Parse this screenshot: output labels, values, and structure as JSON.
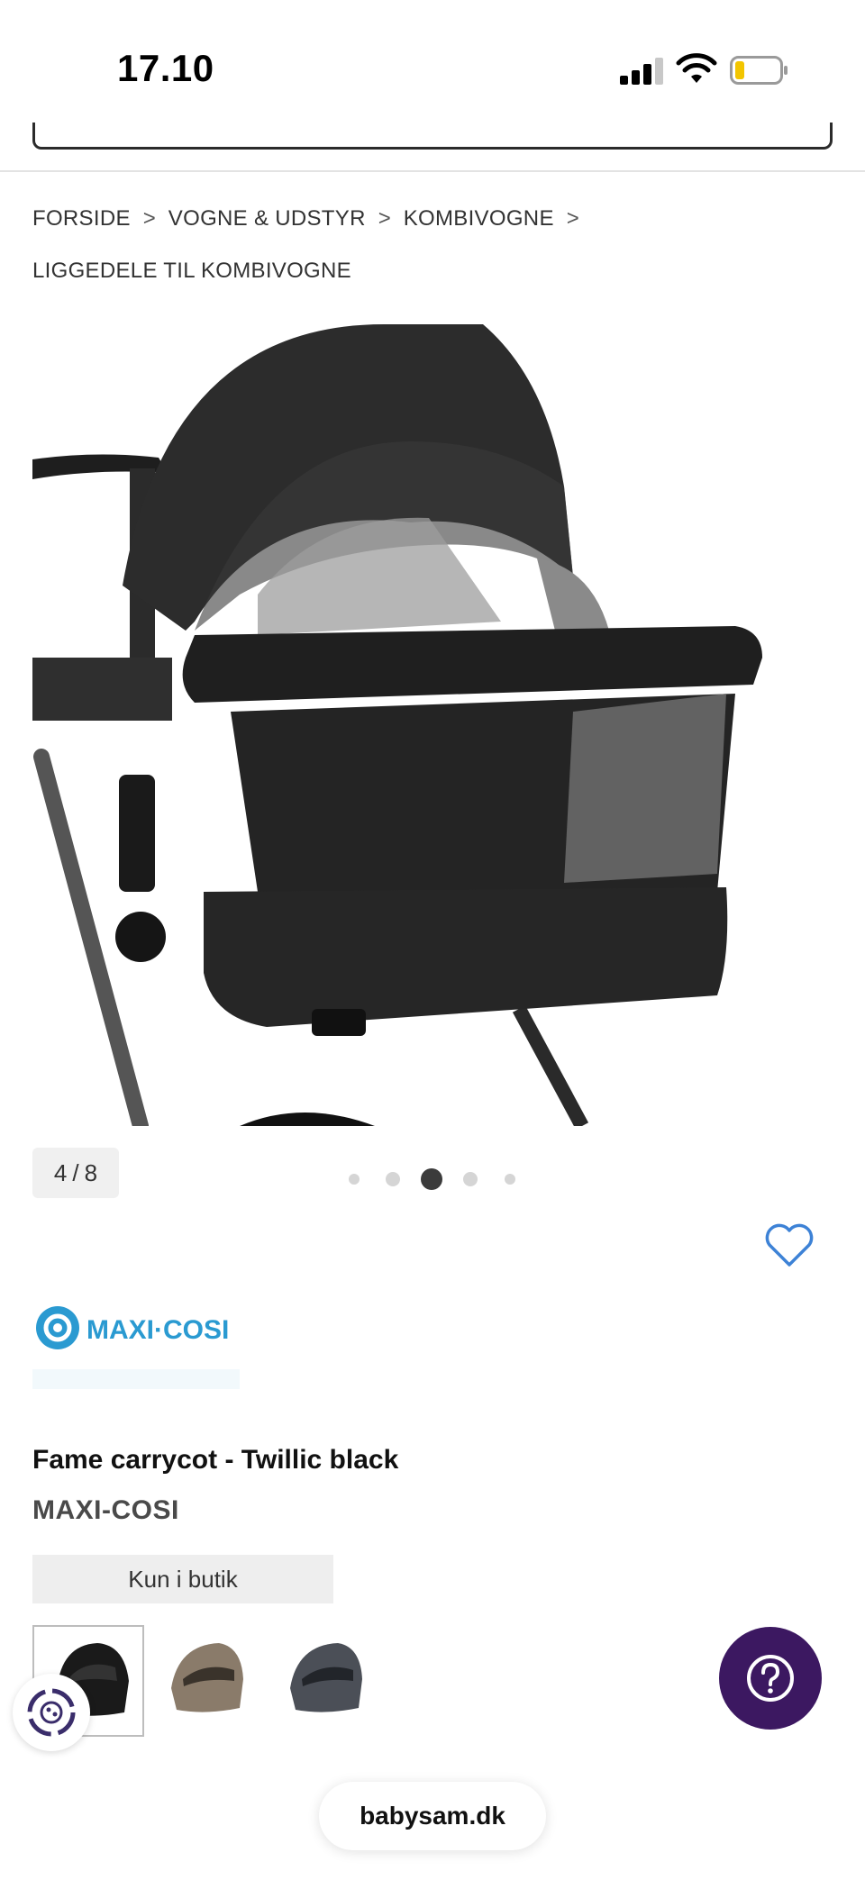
{
  "status_bar": {
    "time": "17.10"
  },
  "breadcrumb": [
    {
      "label": "FORSIDE"
    },
    {
      "label": "VOGNE & UDSTYR"
    },
    {
      "label": "KOMBIVOGNE"
    },
    {
      "label": "LIGGEDELE TIL KOMBIVOGNE"
    }
  ],
  "breadcrumb_separator": ">",
  "gallery": {
    "current": "4",
    "separator": "/",
    "total": "8",
    "active_dot": 3,
    "dot_count": 5
  },
  "brand_logo_text": "MAXI·COSI",
  "product": {
    "title": "Fame carrycot - Twillic black",
    "brand": "MAXI-COSI",
    "availability": "Kun i butik"
  },
  "variants": [
    {
      "name": "carrycot-black",
      "color": "#1a1a1a"
    },
    {
      "name": "carrycot-beige",
      "color": "#8a7b6a"
    },
    {
      "name": "carrycot-grey",
      "color": "#4b4f57"
    }
  ],
  "browser": {
    "url": "babysam.dk"
  },
  "colors": {
    "accent_blue": "#3d82d6",
    "help_purple": "#3c1861",
    "logo_teal": "#2a9ad1"
  }
}
